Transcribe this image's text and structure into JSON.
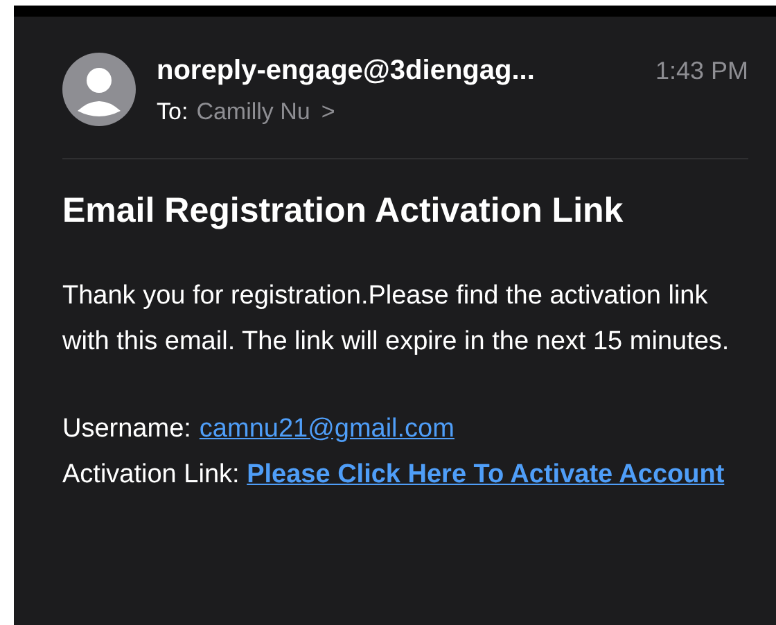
{
  "header": {
    "sender": "noreply-engage@3diengag...",
    "time": "1:43 PM",
    "to_label": "To:",
    "recipient": "Camilly Nu",
    "chevron": ">"
  },
  "subject": "Email Registration Activation Link",
  "body": "Thank you for registration.Please find the activation link with this email. The link will expire in the next 15 minutes.",
  "username": {
    "label": "Username:",
    "value": "camnu21@gmail.com"
  },
  "activation": {
    "label": "Activation Link:",
    "link": "Please Click Here To Activate Account"
  }
}
